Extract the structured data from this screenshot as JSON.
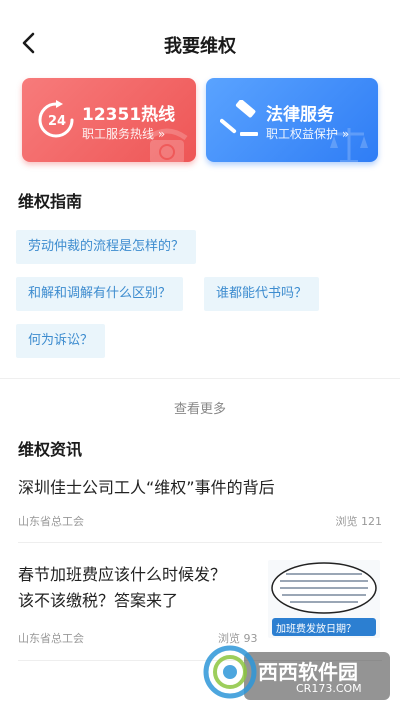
{
  "header": {
    "title": "我要维权"
  },
  "cards": [
    {
      "title": "12351热线",
      "subtitle": "职工服务热线 »",
      "icon": "24h-phone-icon",
      "color": "#ee5656"
    },
    {
      "title": "法律服务",
      "subtitle": "职工权益保护 »",
      "icon": "gavel-icon",
      "color": "#2f7df5"
    }
  ],
  "guide": {
    "title": "维权指南",
    "tags": [
      "劳动仲裁的流程是怎样的？",
      "和解和调解有什么区别？",
      "谁都能代书吗？",
      "何为诉讼？"
    ]
  },
  "more_label": "查看更多",
  "news": {
    "title": "维权资讯",
    "items": [
      {
        "title": "深圳佳士公司工人“维权”事件的背后",
        "source": "山东省总工会",
        "views": "浏览 121"
      },
      {
        "title_line1": "春节加班费应该什么时候发？",
        "title_line2": "该不该缴税？答案来了",
        "source": "山东省总工会",
        "views": "浏览 93"
      }
    ]
  },
  "thumb_caption": "加班费发放日期？",
  "watermark": {
    "brand": "西西软件园",
    "url": "CR173.COM"
  }
}
